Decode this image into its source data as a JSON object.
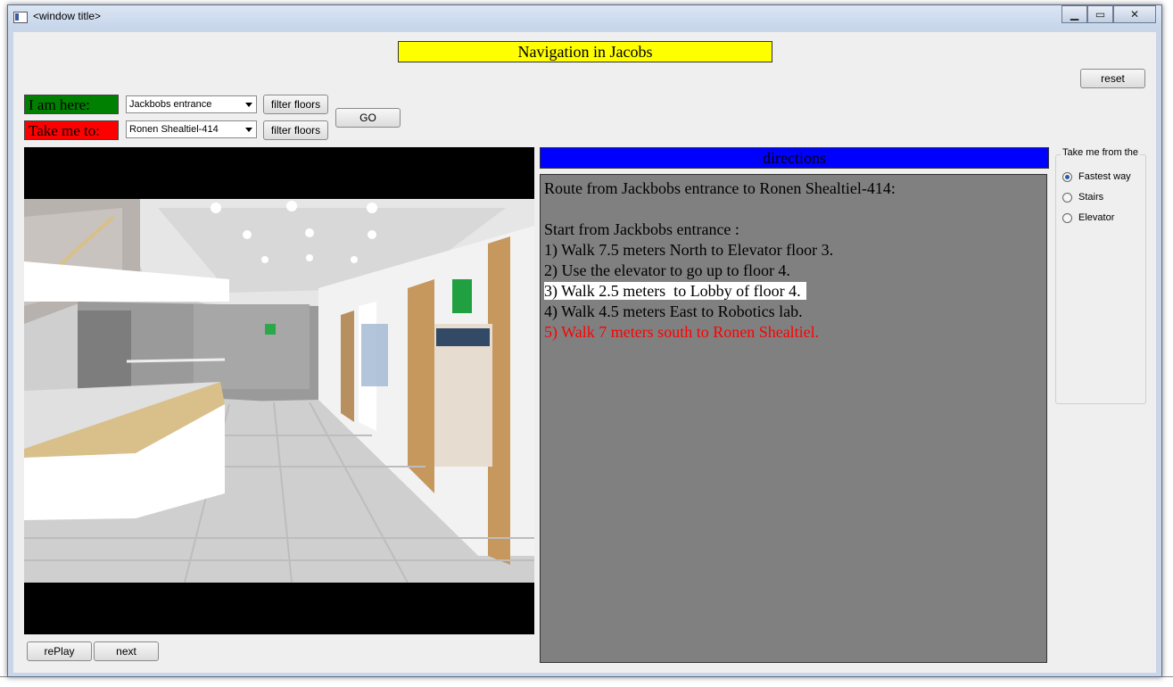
{
  "window": {
    "title": "<window title>",
    "minimize_glyph": "▁",
    "maximize_glyph": "▭",
    "close_glyph": "✕"
  },
  "header": {
    "title": "Navigation in Jacobs",
    "reset_label": "reset"
  },
  "origin": {
    "label": "I am here:",
    "selected": "Jackbobs entrance",
    "filter_label": "filter floors"
  },
  "destination": {
    "label": "Take me to:",
    "selected": "Ronen Shealtiel-414",
    "filter_label": "filter floors"
  },
  "go_label": "GO",
  "directions": {
    "header": "directions",
    "lines": [
      "Route from Jackbobs entrance to Ronen Shealtiel-414:",
      "",
      "Start from Jackbobs entrance :",
      "1) Walk 7.5 meters North to Elevator floor 3.",
      "2) Use the elevator to go up to floor 4.",
      "3) Walk 2.5 meters  to Lobby of floor 4.",
      "4) Walk 4.5 meters East to Robotics lab.",
      "5) Walk 7 meters south to Ronen Shealtiel."
    ],
    "highlighted_step": 3
  },
  "route_options": {
    "title": "Take me from the",
    "options": [
      "Fastest way",
      "Stairs",
      "Elevator"
    ],
    "selected": "Fastest way"
  },
  "playback": {
    "replay_label": "rePlay",
    "next_label": "next"
  },
  "colors": {
    "title_bg": "#ffff00",
    "here_bg": "#008000",
    "to_bg": "#ff0000",
    "directions_header_bg": "#0000ff",
    "directions_panel_bg": "#808080",
    "last_step_color": "#ff0000"
  }
}
